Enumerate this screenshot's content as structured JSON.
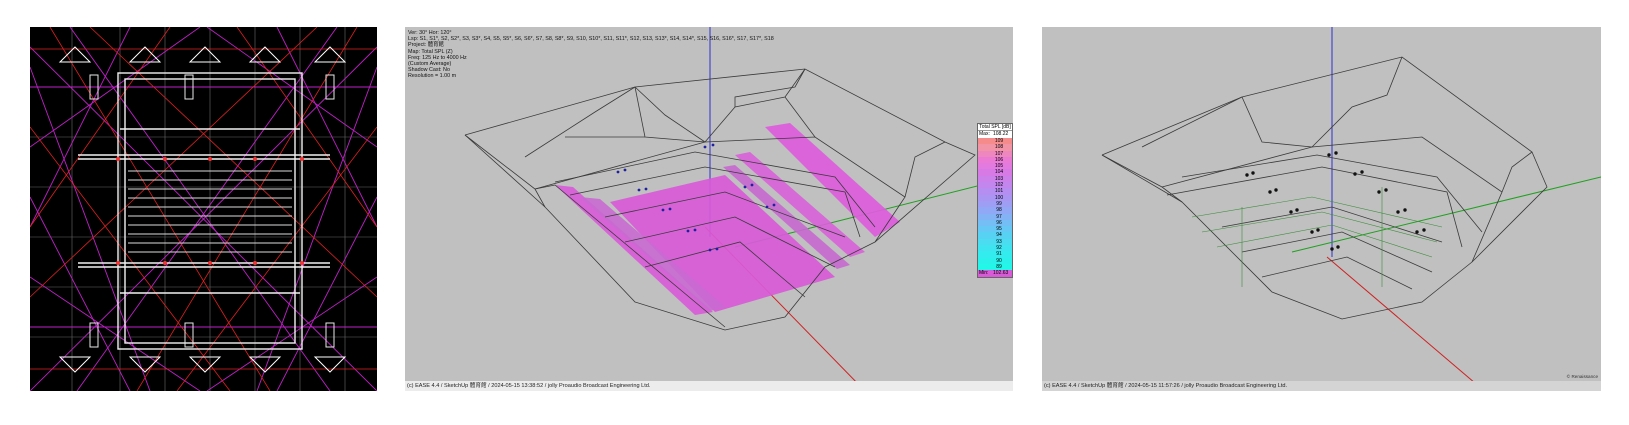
{
  "left_panel": {
    "name": "plan-view-wireframe"
  },
  "middle_panel": {
    "info_lines": [
      "Ver: 30°  Hor: 120°",
      "Lsp: S1, S1*, S2, S2*, S3, S3*, S4, S5, S5*, S6, S6*, S7, S8, S8*, S9, S10, S10*, S11, S11*, S12, S13, S13*, S14, S14*, S15, S16, S16*, S17, S17*, S18",
      "Project: 體育館",
      "Map: Total SPL (Z)",
      "Freq: 125 Hz to 4000 Hz",
      "(Custom Average)",
      "Shadow Cast: No",
      "Resolution =   1.00 m"
    ],
    "legend": {
      "title": "Total SPL [dB]",
      "max_label": "Max:",
      "max_value": "108.22",
      "min_label": "Min:",
      "min_value": "102.63",
      "levels": [
        "109",
        "108",
        "107",
        "106",
        "105",
        "104",
        "103",
        "102",
        "101",
        "100",
        "99",
        "98",
        "97",
        "96",
        "95",
        "94",
        "93",
        "92",
        "91",
        "90",
        "89"
      ],
      "colors": [
        "#f58b8b",
        "#f293a6",
        "#ee86c0",
        "#ea7ad3",
        "#e37ae0",
        "#d87ae6",
        "#cc80ea",
        "#c286ee",
        "#b68df1",
        "#aa95f3",
        "#9d9ef4",
        "#90a8f5",
        "#83b2f5",
        "#74bdf5",
        "#66c8f4",
        "#58d2f3",
        "#4bdcf1",
        "#3ee4ef",
        "#33eced",
        "#2af2ea",
        "#22f7e8"
      ]
    },
    "footer": "(c) EASE 4.4  / SketchUp 體育館  / 2024-05-15 13:38:52 / jolly Proaudio Broadcast Engineering Ltd."
  },
  "right_panel": {
    "footer": "(c) EASE 4.4  / SketchUp 體育館  / 2024-05-15 11:57:26 / jolly Proaudio Broadcast Engineering Ltd.",
    "copyright": "© Renaissance"
  }
}
